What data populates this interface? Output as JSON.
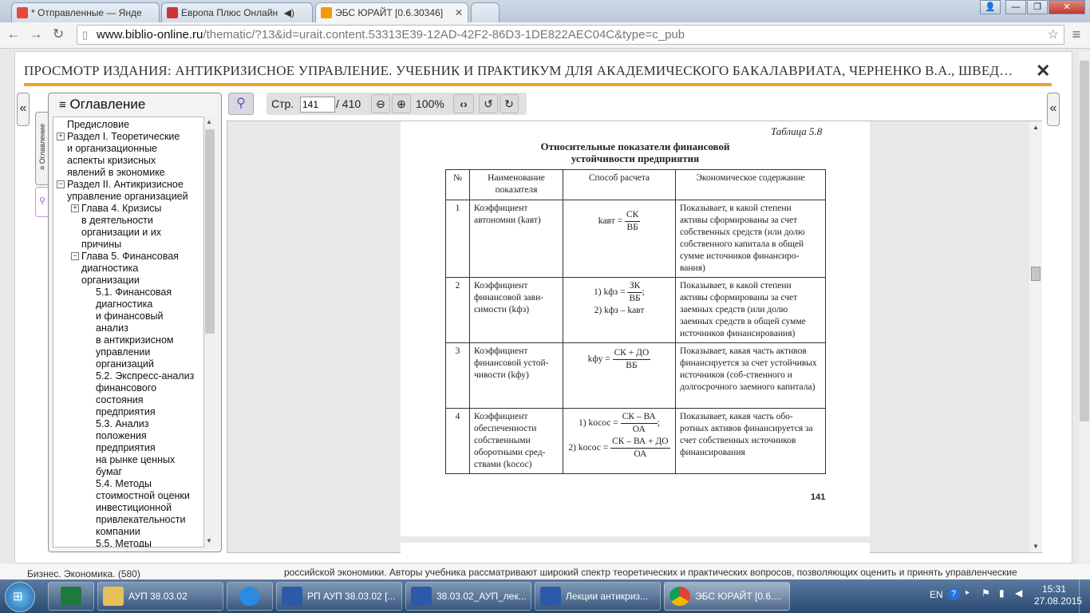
{
  "browser": {
    "tabs": [
      {
        "title": "* Отправленные — Янде",
        "color": "#e8483c"
      },
      {
        "title": "Европа Плюс Онлайн",
        "color": "#c33"
      },
      {
        "title": "ЭБС ЮРАЙТ [0.6.30346]",
        "color": "#f29a00"
      }
    ],
    "url_host": "www.biblio-online.ru",
    "url_path": "/thematic/?13&id=urait.content.53313E39-12AD-42F2-86D3-1DE822AEC04C&type=c_pub"
  },
  "header": {
    "title": "ПРОСМОТР ИЗДАНИЯ: АНТИКРИЗИСНОЕ УПРАВЛЕНИЕ. УЧЕБНИК И ПРАКТИКУМ ДЛЯ АКАДЕМИЧЕСКОГО БАКАЛАВРИАТА, ЧЕРНЕНКО В.А., ШВЕД…",
    "close": "✕",
    "accent": "#f3a12a"
  },
  "sidebar": {
    "toc_tab_label": "≡ Оглавление",
    "collapse": "«",
    "expand": "«"
  },
  "toc": {
    "title": "Оглавление",
    "items": [
      {
        "text": "Предисловие",
        "level": 0,
        "sign": ""
      },
      {
        "text": "Раздел I. Теоретические\nи организационные\nаспекты кризисных\nявлений в экономике",
        "level": 0,
        "sign": "+"
      },
      {
        "text": "Раздел II. Антикризисное\nуправление организацией",
        "level": 0,
        "sign": "−"
      },
      {
        "text": "Глава 4. Кризисы\nв деятельности\nорганизации и их\nпричины",
        "level": 1,
        "sign": "+"
      },
      {
        "text": "Глава 5. Финансовая\nдиагностика\nорганизации",
        "level": 1,
        "sign": "−"
      },
      {
        "text": "5.1. Финансовая\nдиагностика\nи финансовый\nанализ\nв антикризисном\nуправлении\nорганизаций",
        "level": 2,
        "sign": ""
      },
      {
        "text": "5.2. Экспресс-анализ\nфинансового\nсостояния\nпредприятия",
        "level": 2,
        "sign": ""
      },
      {
        "text": "5.3. Анализ\nположения\nпредприятия\nна рынке ценных\nбумаг",
        "level": 2,
        "sign": ""
      },
      {
        "text": "5.4. Методы\nстоимостной оценки\nинвестиционной\nпривлекательности\nкомпании",
        "level": 2,
        "sign": ""
      },
      {
        "text": "5.5. Методы",
        "level": 2,
        "sign": ""
      }
    ]
  },
  "viewer": {
    "page_label": "Стр.",
    "page_value": "141",
    "page_total": "/ 410",
    "zoom": "100%"
  },
  "document": {
    "table_caption": "Таблица 5.8",
    "table_title_1": "Относительные показатели финансовой",
    "table_title_2": "устойчивости предприятия",
    "headers": [
      "№",
      "Наименование показателя",
      "Способ расчета",
      "Экономическое содержание"
    ],
    "rows": [
      {
        "num": "1",
        "name": "Коэффициент автономии (kавт)",
        "desc": "Показывает, в какой степени активы сформированы за счет собственных средств (или долю собственного капитала в общей сумме источников финансиро-вания)"
      },
      {
        "num": "2",
        "name": "Коэффициент финансовой зави-симости (kфз)",
        "desc": "Показывает, в какой степени активы сформированы за счет заемных средств (или долю заемных средств в общей сумме источников финансирования)"
      },
      {
        "num": "3",
        "name": "Коэффициент финансовой устой-чивости (kфу)",
        "desc": "Показывает, какая часть активов финансируется за счет устойчивых источников (соб-ственного и долгосрочного заемного капитала)"
      },
      {
        "num": "4",
        "name": "Коэффициент обеспеченности собственными оборотными сред-ствами (kосос)",
        "desc": "Показывает, какая часть обо-ротных активов финансируется за счет собственных источников финансирования"
      }
    ],
    "formulas": {
      "f1_lhs": "kавт =",
      "f1_num": "СК",
      "f1_den": "ВБ",
      "f2a_lhs": "1)  kфз =",
      "f2a_num": "ЗК",
      "f2a_den": "ВБ",
      "f2a_tail": ";",
      "f2b": "2)  kфз – kавт",
      "f3_lhs": "kфу =",
      "f3_num": "СК + ДО",
      "f3_den": "ВБ",
      "f4a_lhs": "1)  kосос =",
      "f4a_num": "СК – ВА",
      "f4a_den": "ОА",
      "f4a_tail": ";",
      "f4b_lhs": "2)  kосос =",
      "f4b_num": "СК – ВА + ДО",
      "f4b_den": "ОА"
    },
    "page_number": "141"
  },
  "bottom": {
    "left_text": "Бизнес. Экономика. (580)",
    "right_text": "российской экономики. Авторы учебника рассматривают широкий спектр теоретических и практических вопросов, позволяющих оценить и принять управленческие"
  },
  "taskbar": {
    "items": [
      "",
      "АУП 38.03.02",
      "",
      "РП АУП 38.03.02 [...",
      "38.03.02_АУП_лек...",
      "Лекции антикриз...",
      "ЭБС ЮРАЙТ [0.6...."
    ],
    "lang": "EN",
    "time": "15:31",
    "date": "27.08.2015"
  }
}
